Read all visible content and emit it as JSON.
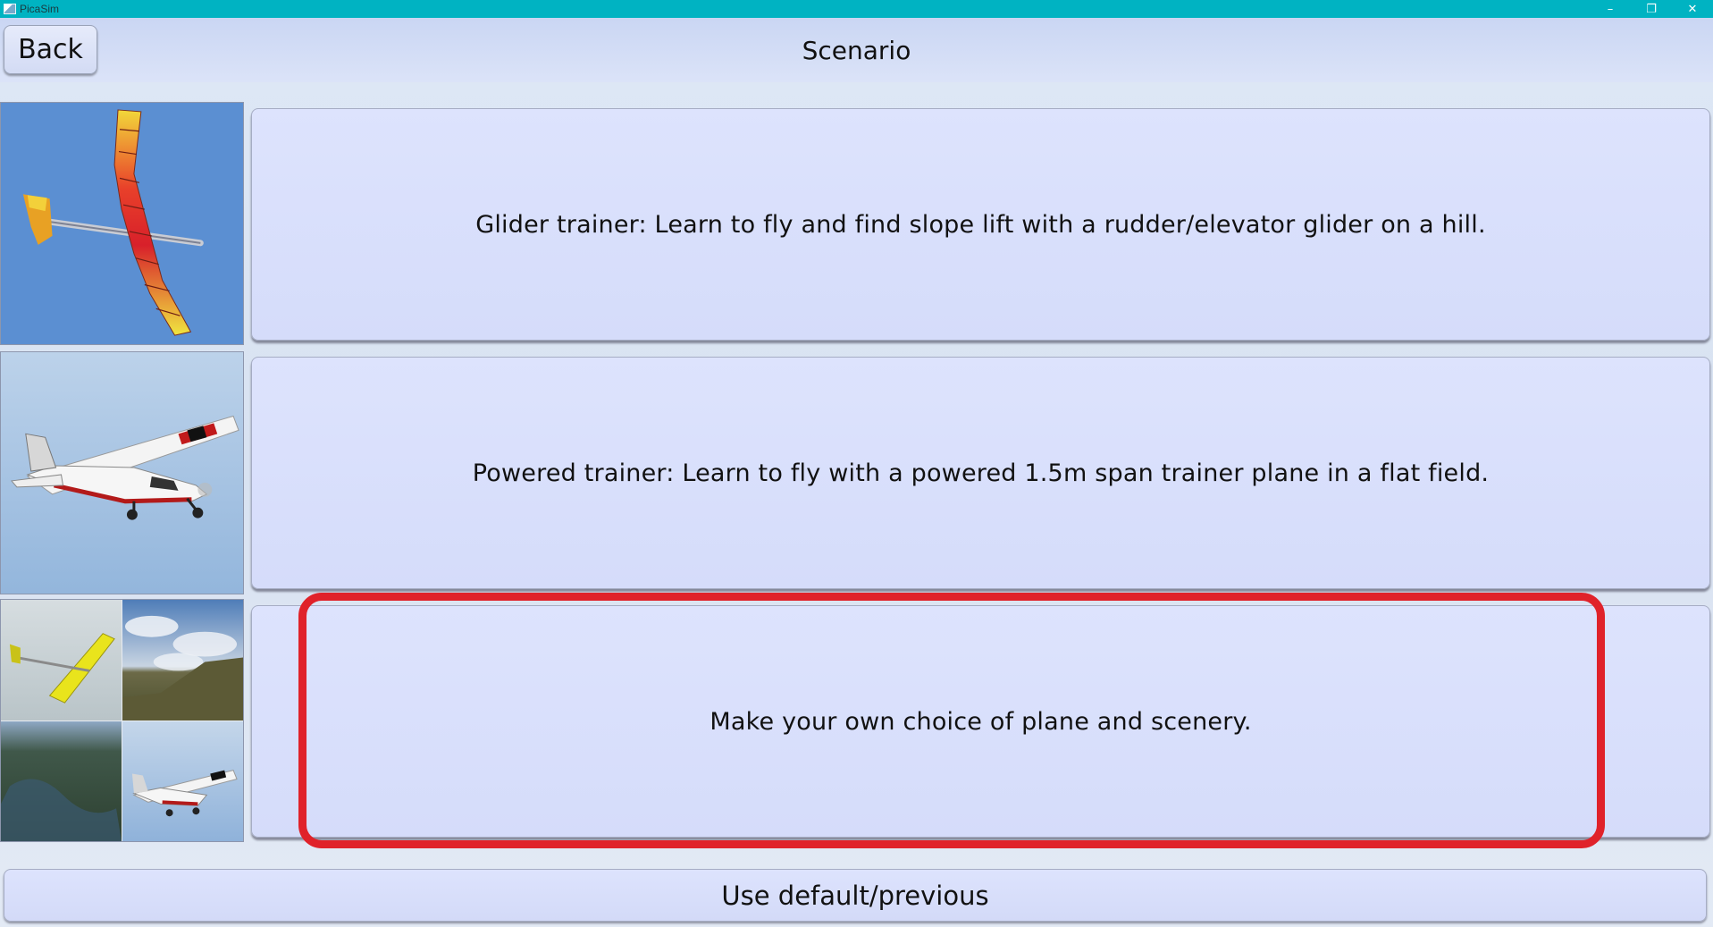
{
  "window": {
    "title": "PicaSim",
    "controls": {
      "minimize": "–",
      "maximize": "❐",
      "close": "✕"
    }
  },
  "header": {
    "back_label": "Back",
    "title": "Scenario"
  },
  "scenarios": [
    {
      "label": "Glider trainer: Learn to fly and find slope lift with a rudder/elevator glider on a hill.",
      "thumbnail": "glider-plane-image"
    },
    {
      "label": "Powered trainer: Learn to fly with a powered 1.5m span trainer plane in a flat field.",
      "thumbnail": "powered-plane-image"
    },
    {
      "label": "Make your own choice of plane and scenery.",
      "thumbnail": "plane-scenery-collage-image",
      "highlighted": true
    }
  ],
  "footer": {
    "default_label": "Use default/previous"
  },
  "colors": {
    "titlebar": "#00b3c2",
    "button_fill": "#d8dffb",
    "highlight": "#e0222a"
  }
}
